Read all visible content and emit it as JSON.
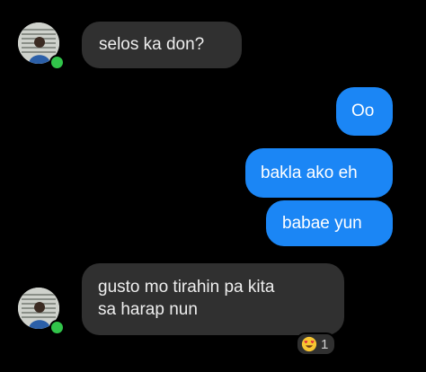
{
  "messages": [
    {
      "side": "incoming",
      "text": "selos ka don?"
    },
    {
      "side": "outgoing",
      "text": "Oo"
    },
    {
      "side": "outgoing",
      "text": "bakla ako eh"
    },
    {
      "side": "outgoing",
      "text": "babae yun"
    },
    {
      "side": "incoming",
      "text_line1": "gusto mo tirahin pa kita",
      "text_line2": "sa harap nun"
    }
  ],
  "reaction": {
    "icon": "heart-eyes-emoji-icon",
    "count": "1"
  },
  "colors": {
    "background": "#000000",
    "incoming_bubble": "#303030",
    "outgoing_bubble": "#1b86f5",
    "online_status": "#31c44a"
  }
}
